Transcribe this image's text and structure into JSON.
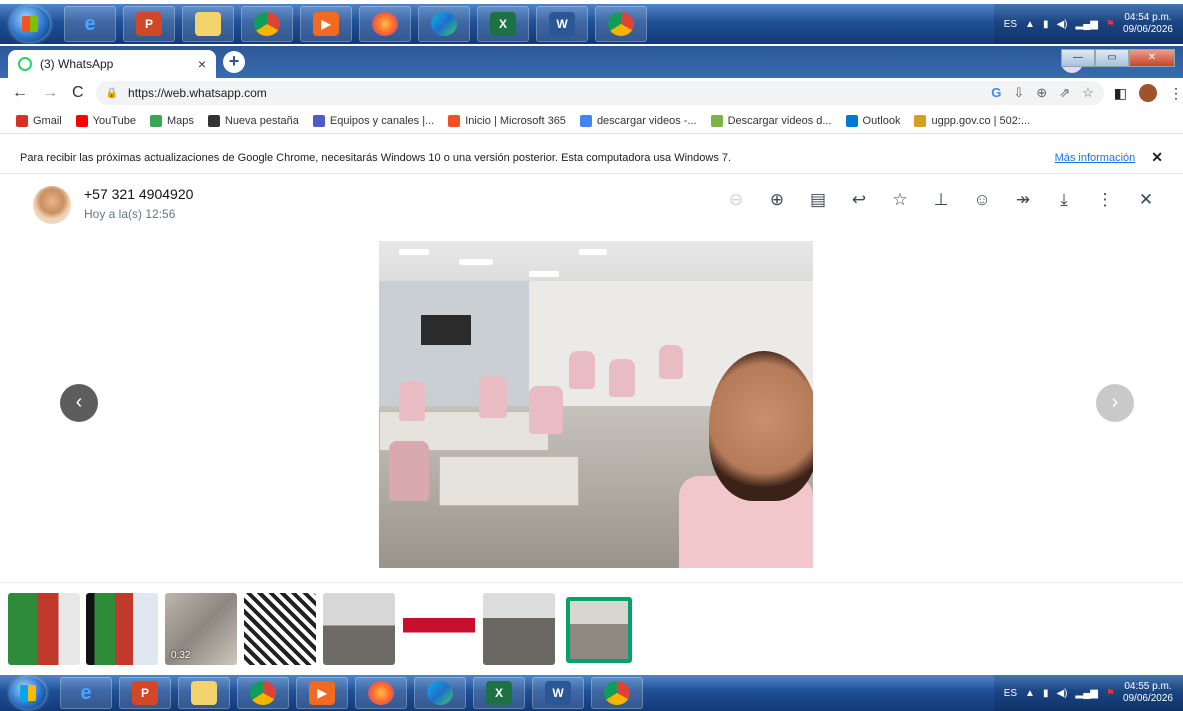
{
  "taskbar": {
    "apps": [
      "internet-explorer",
      "powerpoint",
      "file-explorer",
      "chrome",
      "media-player",
      "firefox",
      "edge",
      "excel",
      "word",
      "chrome-remote"
    ],
    "tray_lang": "ES",
    "top_time": "04:54 p.m.",
    "top_date": "09/06/2026",
    "bottom_time": "04:55 p.m.",
    "bottom_date": "09/06/2026"
  },
  "browser": {
    "tab_title": "(3) WhatsApp",
    "url": "https://web.whatsapp.com",
    "bookmarks": [
      {
        "label": "Gmail",
        "color": "#d93025"
      },
      {
        "label": "YouTube",
        "color": "#ff0000"
      },
      {
        "label": "Maps",
        "color": "#34a853"
      },
      {
        "label": "Nueva pestaña",
        "color": "#333333"
      },
      {
        "label": "Equipos y canales |...",
        "color": "#5059c9"
      },
      {
        "label": "Inicio | Microsoft 365",
        "color": "#f25022"
      },
      {
        "label": "descargar videos -...",
        "color": "#4285f4"
      },
      {
        "label": "Descargar videos d...",
        "color": "#7cb342"
      },
      {
        "label": "Outlook",
        "color": "#0078d4"
      },
      {
        "label": "ugpp.gov.co | 502:...",
        "color": "#d4a020"
      }
    ],
    "info_message": "Para recibir las próximas actualizaciones de Google Chrome, necesitarás Windows 10 o una versión posterior. Esta computadora usa Windows 7.",
    "info_link": "Más información"
  },
  "viewer": {
    "sender": "+57 321 4904920",
    "time": "Hoy a la(s) 12:56",
    "tools": [
      "zoom-out-icon",
      "zoom-in-icon",
      "caption-icon",
      "reply-icon",
      "star-icon",
      "pin-icon",
      "emoji-icon",
      "forward-icon",
      "download-icon",
      "more-icon",
      "close-icon"
    ],
    "thumbnails": [
      {
        "label": "",
        "kind": "spreadsheet"
      },
      {
        "label": "",
        "kind": "spreadsheet"
      },
      {
        "label": "0:32",
        "kind": "video"
      },
      {
        "label": "",
        "kind": "qr"
      },
      {
        "label": "",
        "kind": "classroom"
      },
      {
        "label": "",
        "kind": "flyer"
      },
      {
        "label": "",
        "kind": "classroom"
      },
      {
        "label": "",
        "kind": "classroom-selected"
      }
    ],
    "thumb_duration": "0:32"
  }
}
